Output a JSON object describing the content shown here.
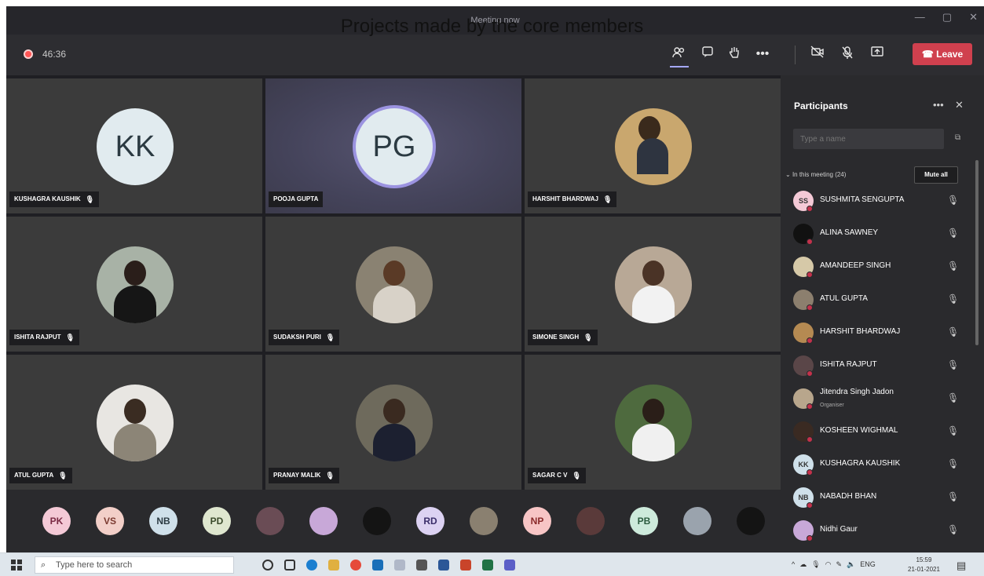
{
  "overlay_caption": "Projects made by the core members",
  "window": {
    "title": "Meeting now",
    "controls": [
      "—",
      "▢",
      "✕"
    ]
  },
  "toolbar": {
    "elapsed": "46:36",
    "leave_label": "Leave"
  },
  "tiles": [
    {
      "name": "KUSHAGRA KAUSHIK",
      "initials": "KK",
      "kind": "initials"
    },
    {
      "name": "POOJA GUPTA",
      "initials": "PG",
      "kind": "initials-active"
    },
    {
      "name": "HARSHIT BHARDWAJ",
      "kind": "photo"
    },
    {
      "name": "ISHITA RAJPUT",
      "kind": "photo"
    },
    {
      "name": "SUDAKSH PURI",
      "kind": "photo"
    },
    {
      "name": "SIMONE SINGH",
      "kind": "photo"
    },
    {
      "name": "ATUL GUPTA",
      "kind": "photo"
    },
    {
      "name": "PRANAY MALIK",
      "kind": "photo"
    },
    {
      "name": "SAGAR C V",
      "kind": "photo"
    }
  ],
  "strip": [
    {
      "initials": "PK",
      "color": "#f4c9d6"
    },
    {
      "initials": "VS",
      "color": "#f2cfc8"
    },
    {
      "initials": "NB",
      "color": "#cfe0ea"
    },
    {
      "initials": "PD",
      "color": "#dfe7cf"
    },
    {
      "initials": "",
      "color": "#6a4c55"
    },
    {
      "initials": "",
      "color": "#c8a8d8"
    },
    {
      "initials": "",
      "color": "#141414"
    },
    {
      "initials": "RD",
      "color": "#dcd2f2"
    },
    {
      "initials": "",
      "color": "#8a8070"
    },
    {
      "initials": "NP",
      "color": "#f7c5c5"
    },
    {
      "initials": "",
      "color": "#5a3a3a"
    },
    {
      "initials": "PB",
      "color": "#cdeadb"
    },
    {
      "initials": "",
      "color": "#9aa3ad"
    },
    {
      "initials": "",
      "color": "#141414"
    }
  ],
  "participants": {
    "title": "Participants",
    "search_placeholder": "Type a name",
    "section_label": "In this meeting (24)",
    "mute_all_label": "Mute all",
    "list": [
      {
        "name": "SUSHMITA SENGUPTA",
        "initials": "SS",
        "color": "#f4c9d6",
        "sub": ""
      },
      {
        "name": "ALINA SAWNEY",
        "initials": "",
        "color": "#111111",
        "sub": ""
      },
      {
        "name": "AMANDEEP SINGH",
        "initials": "",
        "color": "#d6c9a8",
        "sub": ""
      },
      {
        "name": "ATUL GUPTA",
        "initials": "",
        "color": "#8c7f6e",
        "sub": ""
      },
      {
        "name": "HARSHIT BHARDWAJ",
        "initials": "",
        "color": "#b58a52",
        "sub": ""
      },
      {
        "name": "ISHITA RAJPUT",
        "initials": "",
        "color": "#5a4648",
        "sub": ""
      },
      {
        "name": "Jitendra Singh Jadon",
        "initials": "",
        "color": "#b8a68c",
        "sub": "Organiser"
      },
      {
        "name": "KOSHEEN WIGHMAL",
        "initials": "",
        "color": "#3a2a22",
        "sub": ""
      },
      {
        "name": "KUSHAGRA KAUSHIK",
        "initials": "KK",
        "color": "#cfe0ea",
        "sub": ""
      },
      {
        "name": "NABADH BHAN",
        "initials": "NB",
        "color": "#cfe0ea",
        "sub": ""
      },
      {
        "name": "Nidhi Gaur",
        "initials": "",
        "color": "#c8a8d8",
        "sub": ""
      }
    ]
  },
  "taskbar": {
    "search_placeholder": "Type here to search",
    "tray_lang": "ENG",
    "time": "15:59",
    "date": "21-01-2021"
  }
}
